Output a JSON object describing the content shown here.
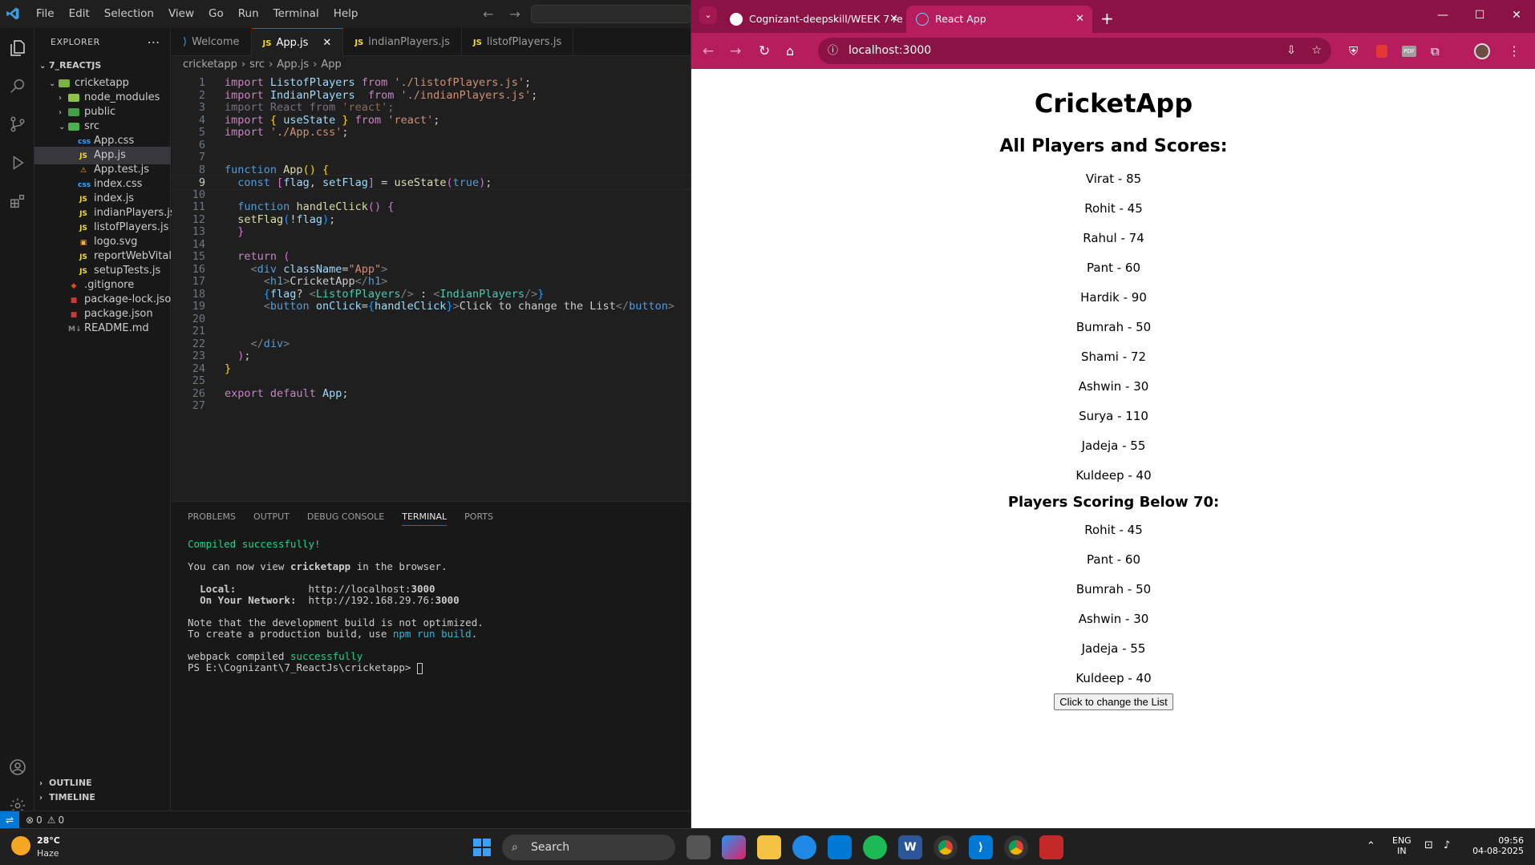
{
  "vscode": {
    "menu": [
      "File",
      "Edit",
      "Selection",
      "View",
      "Go",
      "Run",
      "Terminal",
      "Help"
    ],
    "explorer": {
      "title": "EXPLORER",
      "root": "7_REACTJS",
      "items": [
        {
          "label": "cricketapp",
          "depth": 1,
          "type": "folder-open",
          "color": "#7cb342"
        },
        {
          "label": "node_modules",
          "depth": 2,
          "type": "folder",
          "color": "#8bc34a"
        },
        {
          "label": "public",
          "depth": 2,
          "type": "folder",
          "color": "#43a047"
        },
        {
          "label": "src",
          "depth": 2,
          "type": "folder-open",
          "color": "#4caf50"
        },
        {
          "label": "App.css",
          "depth": 3,
          "type": "css"
        },
        {
          "label": "App.js",
          "depth": 3,
          "type": "js",
          "selected": true
        },
        {
          "label": "App.test.js",
          "depth": 3,
          "type": "test"
        },
        {
          "label": "index.css",
          "depth": 3,
          "type": "css"
        },
        {
          "label": "index.js",
          "depth": 3,
          "type": "js"
        },
        {
          "label": "indianPlayers.js",
          "depth": 3,
          "type": "js"
        },
        {
          "label": "listofPlayers.js",
          "depth": 3,
          "type": "js"
        },
        {
          "label": "logo.svg",
          "depth": 3,
          "type": "svg"
        },
        {
          "label": "reportWebVital...",
          "depth": 3,
          "type": "js"
        },
        {
          "label": "setupTests.js",
          "depth": 3,
          "type": "js"
        },
        {
          "label": ".gitignore",
          "depth": 2,
          "type": "git"
        },
        {
          "label": "package-lock.json",
          "depth": 2,
          "type": "npm"
        },
        {
          "label": "package.json",
          "depth": 2,
          "type": "npm"
        },
        {
          "label": "README.md",
          "depth": 2,
          "type": "md"
        }
      ],
      "outline": "OUTLINE",
      "timeline": "TIMELINE"
    },
    "tabs": [
      {
        "label": "Welcome",
        "icon": "vscode-icon"
      },
      {
        "label": "App.js",
        "icon": "js-icon",
        "active": true
      },
      {
        "label": "indianPlayers.js",
        "icon": "js-icon"
      },
      {
        "label": "listofPlayers.js",
        "icon": "js-icon"
      }
    ],
    "breadcrumb": [
      "cricketapp",
      "src",
      "App.js",
      "App"
    ],
    "code": [
      {
        "n": "1",
        "html": "<span class='kw2'>import</span> <span class='var'>ListofPlayers</span> <span class='kw2'>from</span> <span class='str'>'./listofPlayers.js'</span><span class='pun'>;</span>"
      },
      {
        "n": "2",
        "html": "<span class='kw2'>import</span> <span class='var'>IndianPlayers</span>  <span class='kw2'>from</span> <span class='str'>'./indianPlayers.js'</span><span class='pun'>;</span>"
      },
      {
        "n": "3",
        "html": "<span style='color:#7a6f80'>import React from </span><span style='color:#8a6a5a'>'react'</span><span style='color:#777'>;</span>"
      },
      {
        "n": "4",
        "html": "<span class='kw2'>import</span> <span class='br'>{</span> <span class='var'>useState</span> <span class='br'>}</span> <span class='kw2'>from</span> <span class='str'>'react'</span><span class='pun'>;</span>"
      },
      {
        "n": "5",
        "html": "<span class='kw2'>import</span> <span class='str'>'./App.css'</span><span class='pun'>;</span>"
      },
      {
        "n": "6",
        "html": ""
      },
      {
        "n": "7",
        "html": ""
      },
      {
        "n": "8",
        "html": "<span class='kw'>function</span> <span class='fn'>App</span><span class='br'>()</span> <span class='br'>{</span>"
      },
      {
        "n": "9",
        "html": "  <span class='kw'>const</span> <span class='br2'>[</span><span class='var'>flag</span><span class='pun'>,</span> <span class='var'>setFlag</span><span class='br2'>]</span> <span class='pun'>=</span> <span class='fn'>useState</span><span class='br2'>(</span><span class='kw'>true</span><span class='br2'>)</span><span class='pun'>;</span>",
        "current": true
      },
      {
        "n": "10",
        "html": ""
      },
      {
        "n": "11",
        "html": "  <span class='kw'>function</span> <span class='fn'>handleClick</span><span class='br2'>()</span> <span class='br2'>{</span>"
      },
      {
        "n": "12",
        "html": "  <span class='fn'>setFlag</span><span class='br3'>(</span><span class='pun'>!</span><span class='var'>flag</span><span class='br3'>)</span><span class='pun'>;</span>"
      },
      {
        "n": "13",
        "html": "  <span class='br2'>}</span>"
      },
      {
        "n": "14",
        "html": ""
      },
      {
        "n": "15",
        "html": "  <span class='kw2'>return</span> <span class='br2'>(</span>"
      },
      {
        "n": "16",
        "html": "    <span style='color:#808080'>&lt;</span><span class='tag'>div</span> <span class='var'>className</span><span class='pun'>=</span><span class='str'>\"App\"</span><span style='color:#808080'>&gt;</span>"
      },
      {
        "n": "17",
        "html": "      <span style='color:#808080'>&lt;</span><span class='tag'>h1</span><span style='color:#808080'>&gt;</span><span class='pun'>CricketApp</span><span style='color:#808080'>&lt;/</span><span class='tag'>h1</span><span style='color:#808080'>&gt;</span>"
      },
      {
        "n": "18",
        "html": "      <span class='br3'>{</span><span class='var'>flag</span><span class='pun'>?</span> <span style='color:#808080'>&lt;</span><span class='comp'>ListofPlayers</span><span style='color:#808080'>/&gt;</span> <span class='pun'>:</span> <span style='color:#808080'>&lt;</span><span class='comp'>IndianPlayers</span><span style='color:#808080'>/&gt;</span><span class='br3'>}</span>"
      },
      {
        "n": "19",
        "html": "      <span style='color:#808080'>&lt;</span><span class='tag'>button</span> <span class='var'>onClick</span><span class='pun'>=</span><span class='br3'>{</span><span class='var'>handleClick</span><span class='br3'>}</span><span style='color:#808080'>&gt;</span><span class='pun'>Click to change the List</span><span style='color:#808080'>&lt;/</span><span class='tag'>button</span><span style='color:#808080'>&gt;</span>"
      },
      {
        "n": "20",
        "html": ""
      },
      {
        "n": "21",
        "html": ""
      },
      {
        "n": "22",
        "html": "    <span style='color:#808080'>&lt;/</span><span class='tag'>div</span><span style='color:#808080'>&gt;</span>"
      },
      {
        "n": "23",
        "html": "  <span class='br2'>)</span><span class='pun'>;</span>"
      },
      {
        "n": "24",
        "html": "<span class='br'>}</span>"
      },
      {
        "n": "25",
        "html": ""
      },
      {
        "n": "26",
        "html": "<span class='kw2'>export</span> <span class='kw2'>default</span> <span class='var'>App</span><span class='pun'>;</span>"
      },
      {
        "n": "27",
        "html": ""
      }
    ],
    "panel_tabs": [
      "PROBLEMS",
      "OUTPUT",
      "DEBUG CONSOLE",
      "TERMINAL",
      "PORTS"
    ],
    "terminal": [
      {
        "html": "<span style='color:#23d18b'>Compiled successfully!</span>"
      },
      {
        "html": ""
      },
      {
        "html": "You can now view <b>cricketapp</b> in the browser."
      },
      {
        "html": ""
      },
      {
        "html": "  <b>Local:</b>            http://localhost:<b>3000</b>"
      },
      {
        "html": "  <b>On Your Network:</b>  http://192.168.29.76:<b>3000</b>"
      },
      {
        "html": ""
      },
      {
        "html": "Note that the development build is not optimized."
      },
      {
        "html": "To create a production build, use <span style='color:#29b8db'>npm run build</span>."
      },
      {
        "html": ""
      },
      {
        "html": "webpack compiled <span style='color:#23d18b'>successfully</span>"
      },
      {
        "html": "PS E:\\Cognizant\\7_ReactJs\\cricketapp> <span style='border:1px solid #ccc;display:inline-block;width:7px;height:14px;vertical-align:middle'></span>"
      }
    ],
    "status": {
      "errors": "0",
      "warnings": "0"
    }
  },
  "browser": {
    "tabs": [
      {
        "label": "Cognizant-deepskill/WEEK 7 re",
        "icon": "github-icon"
      },
      {
        "label": "React App",
        "icon": "react-icon",
        "active": true
      }
    ],
    "url": "localhost:3000",
    "page": {
      "title": "CricketApp",
      "all_heading": "All Players and Scores:",
      "all_players": [
        "Virat - 85",
        "Rohit - 45",
        "Rahul - 74",
        "Pant - 60",
        "Hardik - 90",
        "Bumrah - 50",
        "Shami - 72",
        "Ashwin - 30",
        "Surya - 110",
        "Jadeja - 55",
        "Kuldeep - 40"
      ],
      "below_heading": "Players Scoring Below 70:",
      "below_players": [
        "Rohit - 45",
        "Pant - 60",
        "Bumrah - 50",
        "Ashwin - 30",
        "Jadeja - 55",
        "Kuldeep - 40"
      ],
      "button": "Click to change the List"
    }
  },
  "taskbar": {
    "temp": "28°C",
    "weather": "Haze",
    "search": "Search",
    "lang": "ENG",
    "region": "IN",
    "time": "09:56",
    "date": "04-08-2025"
  }
}
